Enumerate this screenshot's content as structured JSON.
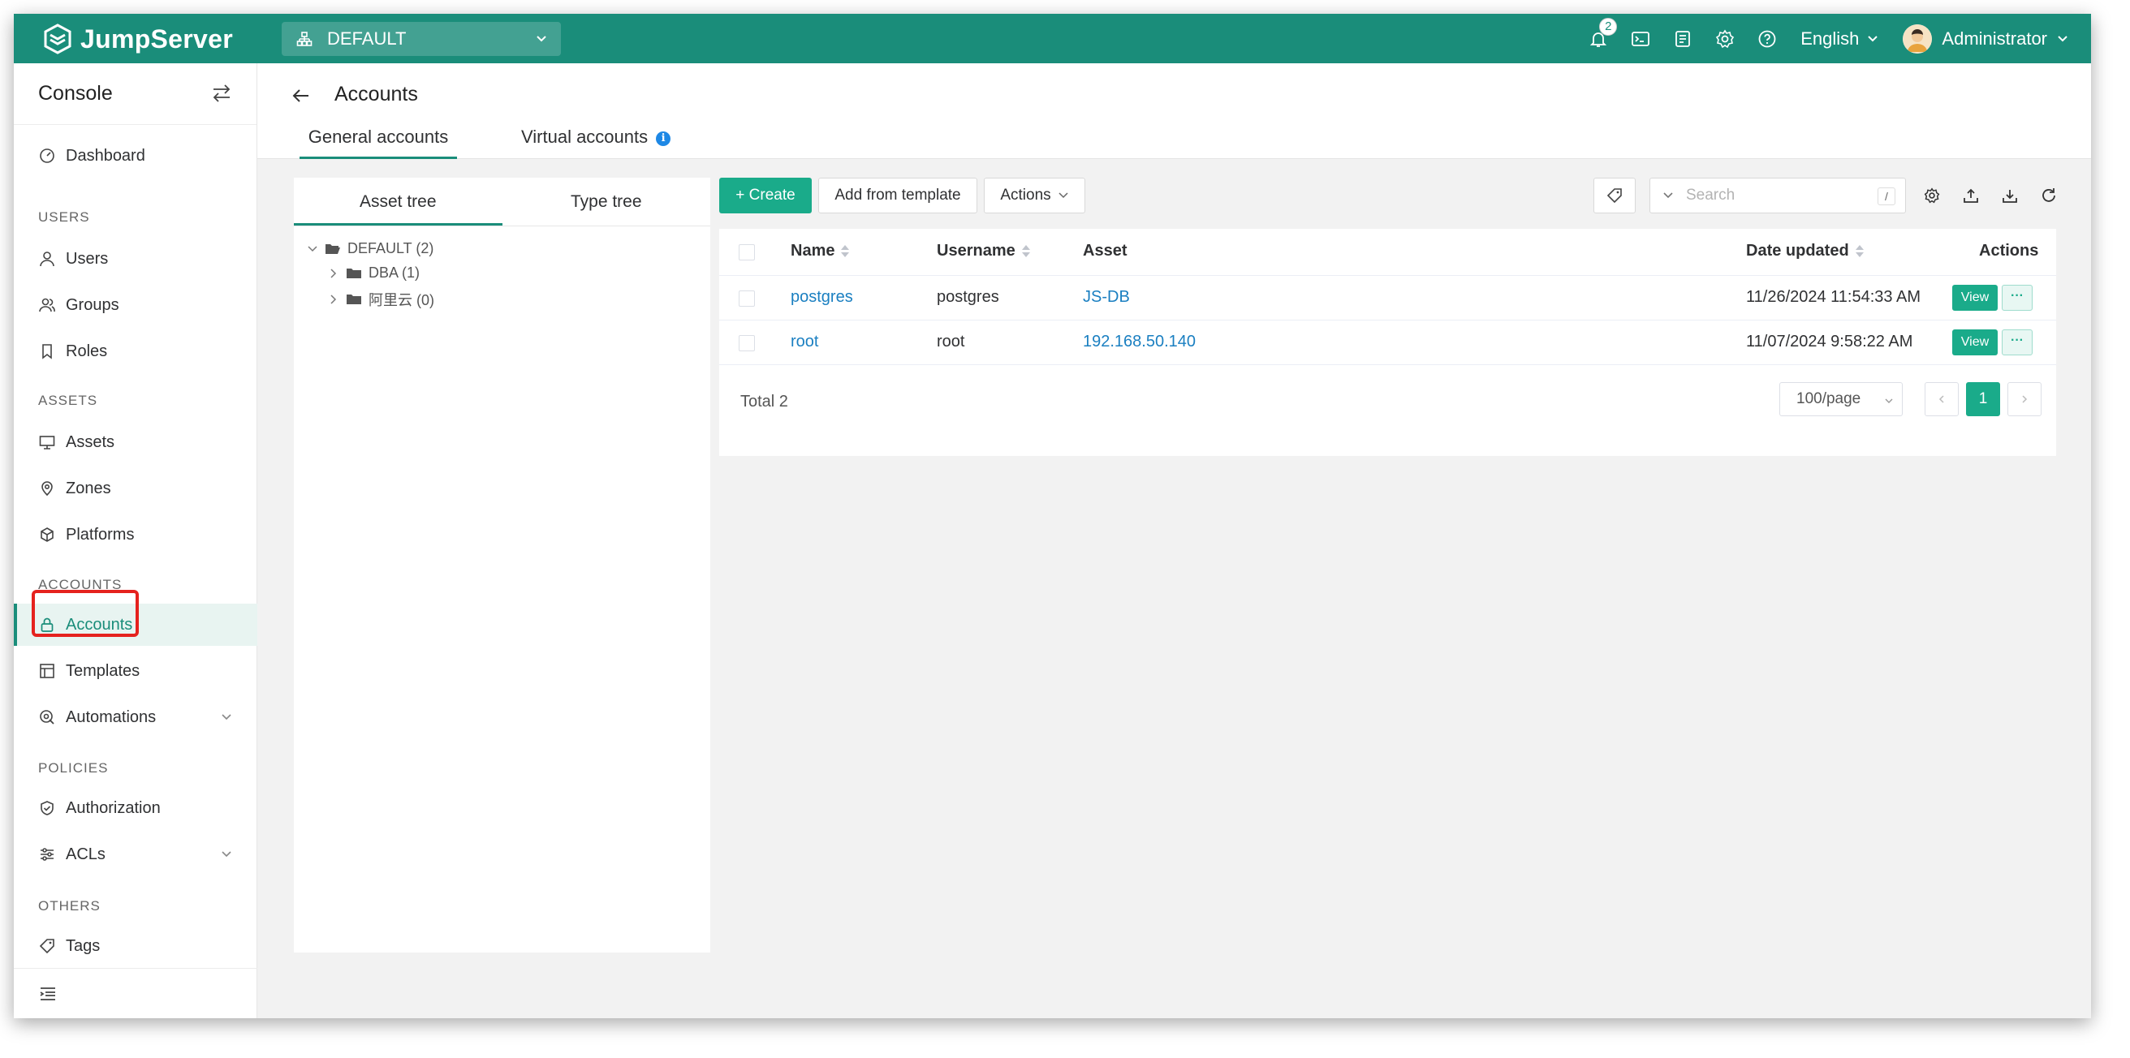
{
  "app": {
    "logo_text": "JumpServer",
    "org_selector": "DEFAULT",
    "notification_count": "2",
    "language": "English",
    "user_name": "Administrator"
  },
  "sidebar": {
    "title": "Console",
    "dashboard": "Dashboard",
    "sections": {
      "users": "USERS",
      "assets": "ASSETS",
      "accounts": "ACCOUNTS",
      "policies": "POLICIES",
      "others": "OTHERS"
    },
    "items": {
      "users": "Users",
      "groups": "Groups",
      "roles": "Roles",
      "assets": "Assets",
      "zones": "Zones",
      "platforms": "Platforms",
      "accounts": "Accounts",
      "templates": "Templates",
      "automations": "Automations",
      "authorization": "Authorization",
      "acls": "ACLs",
      "tags": "Tags"
    },
    "active_item": "Accounts"
  },
  "page": {
    "title": "Accounts",
    "tabs": [
      "General accounts",
      "Virtual accounts"
    ],
    "active_tab": "General accounts"
  },
  "tree": {
    "tabs": [
      "Asset tree",
      "Type tree"
    ],
    "active_tab": "Asset tree",
    "root": "DEFAULT (2)",
    "children": [
      "DBA (1)",
      "阿里云 (0)"
    ]
  },
  "toolbar": {
    "create": "+ Create",
    "add_from_template": "Add from template",
    "actions": "Actions",
    "search_placeholder": "Search",
    "search_shortcut": "/"
  },
  "table": {
    "columns": [
      "Name",
      "Username",
      "Asset",
      "Date updated",
      "Actions"
    ],
    "rows": [
      {
        "name": "postgres",
        "username": "postgres",
        "asset": "JS-DB",
        "date_updated": "11/26/2024 11:54:33 AM",
        "view": "View",
        "more": "···"
      },
      {
        "name": "root",
        "username": "root",
        "asset": "192.168.50.140",
        "date_updated": "11/07/2024 9:58:22 AM",
        "view": "View",
        "more": "···"
      }
    ],
    "total": "Total 2",
    "page_size": "100/page",
    "current_page": "1"
  },
  "colors": {
    "brand": "#1a8d7a",
    "primary_button": "#1aab8a",
    "link": "#1a7fc1",
    "highlight_box": "#e5221e"
  }
}
